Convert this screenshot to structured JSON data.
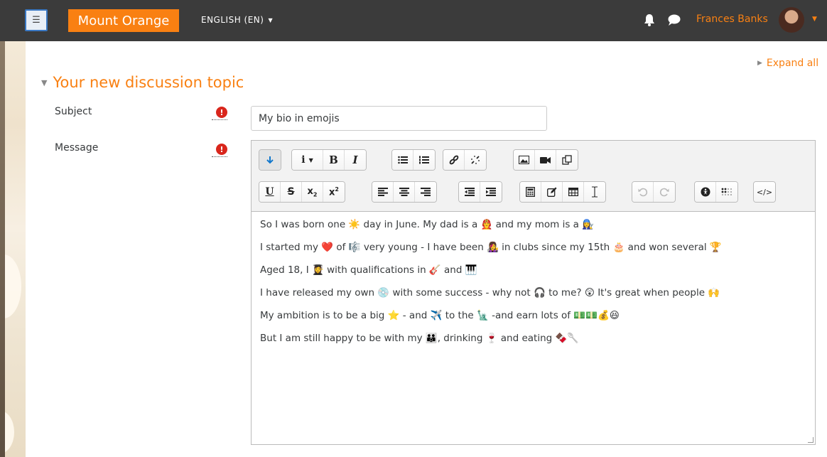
{
  "navbar": {
    "toggle_icon": "hamburger-icon",
    "brand": "Mount Orange",
    "language": "ENGLISH (EN)",
    "user_name": "Frances Banks",
    "brand_color": "#f98012",
    "bg_color": "#3b3b3b"
  },
  "page": {
    "expand_all": "Expand all",
    "section_title": "Your new discussion topic"
  },
  "form": {
    "subject_label": "Subject",
    "subject_value": "My bio in emojis",
    "message_label": "Message",
    "required_icon": "exclamation-circle-icon"
  },
  "editor": {
    "toolbar_row1": [
      "collapse",
      "style",
      "bold",
      "italic",
      "unordered-list",
      "ordered-list",
      "link",
      "unlink",
      "image",
      "media",
      "manage-files"
    ],
    "toolbar_row2": [
      "underline",
      "strikethrough",
      "subscript",
      "superscript",
      "align-left",
      "align-center",
      "align-right",
      "outdent",
      "indent",
      "equation",
      "special-character",
      "table",
      "clear-formatting",
      "undo",
      "redo",
      "accessibility-checker",
      "screenreader-helper",
      "html"
    ],
    "lines": [
      "So I was born one ☀️ day in June. My dad is a 👨‍🚒 and my mom is a 👩‍🔧",
      "I started my ❤️ of 🎼 very young - I have been 👩‍🎤 in clubs since my 15th 🎂 and won several 🏆",
      "Aged 18, I 👩‍🎓 with qualifications in 🎸 and 🎹",
      "I have released my own 💿 with some success  - why not 🎧 to me? 😲 It's great when people 🙌",
      "My ambition is to be a big ⭐ - and ✈️ to the 🗽 -and earn lots of 💵💵💰😆",
      "But I am still happy to be with my 👪, drinking  🍷 and eating 🍫🥄"
    ]
  }
}
